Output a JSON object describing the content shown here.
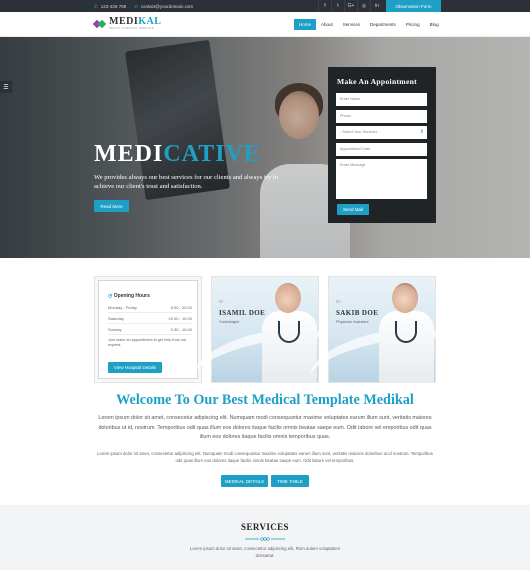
{
  "topbar": {
    "phone": "123-436-789",
    "email": "contact@yourdomain.com",
    "social_icons": [
      "facebook-icon",
      "twitter-icon",
      "google-plus-icon",
      "instagram-icon",
      "linkedin-icon"
    ],
    "social_glyphs": [
      "f",
      "t",
      "G+",
      "◎",
      "in"
    ],
    "observation_button": "Observation Form"
  },
  "brand": {
    "name_part1": "MEDI",
    "name_part2": "KAL",
    "tagline": "HEALTH & MEDICAL TEMPLATE",
    "accent_color": "#1ea0c6",
    "dark_color": "#1f2427"
  },
  "nav": {
    "items": [
      "Home",
      "About",
      "Services",
      "Departments",
      "Pricing",
      "Blog"
    ],
    "active": "Home"
  },
  "hero": {
    "title_part1": "MEDI",
    "title_part2": "CATIVE",
    "description": "We provides always our best services for our clients and always try to achieve our client's trust and satisfaction.",
    "button": "Read More"
  },
  "appointment": {
    "title": "Make An Appointment",
    "name_placeholder": "Enter Name",
    "phone_placeholder": "Phone",
    "services_select": "- Select Your Services -",
    "date_placeholder": "Appointment Date",
    "message_placeholder": "Enter Message",
    "submit": "Send Mail"
  },
  "opening_hours": {
    "title": "Opening Hours",
    "rows": [
      {
        "day": "Monday - Friday",
        "time": "8.00 - 20.00"
      },
      {
        "day": "Saturday",
        "time": "15.00 - 16.00"
      },
      {
        "day": "Sunday",
        "time": "9.30 - 18.00"
      }
    ],
    "note": "Just make an appointment to get help from our experts",
    "button": "View Hospital Details"
  },
  "doctors": [
    {
      "prefix": "Dr.",
      "name": "ISAMIL DOE",
      "role": "Cardiologist"
    },
    {
      "prefix": "Dr.",
      "name": "SAKIB DOE",
      "role": "Physician Assistant"
    }
  ],
  "welcome": {
    "title": "Welcome To Our Best Medical Template Medikal",
    "lead": "Lorem ipsum dolor sit amet, consecetur adipiscing elit. Numquam modi consequuntur maxime voluptates earum illum sunt, veritatis maiores doloribus ut id, nostrum. Temporibus odit quas illum eos dolores itaque facilis omnis beatae saepe eum. Odit labore vel emporibus odit quas illum eos dolores itaque facilis omnis temporibus quas.",
    "small": "Lorem ipsum dolor sit amet, consectetur adipiscing elit. Numquam modi consequuntur maxime voluptates earum illum sunt, veritatis maiores doloribus ut id nostrum. Temporibus odit quas illum eos dolores itaque facilis omnis beatae saepe eum. Odit labore vel temporibus.",
    "button1": "MEDIKAL DETAILS",
    "button2": "TIME TABLE"
  },
  "services": {
    "title": "SERVICES",
    "text": "Lorem ipsum dolor sit amet, consectetur adipiscing elit. Rem autem voluptatem dossatrat."
  }
}
